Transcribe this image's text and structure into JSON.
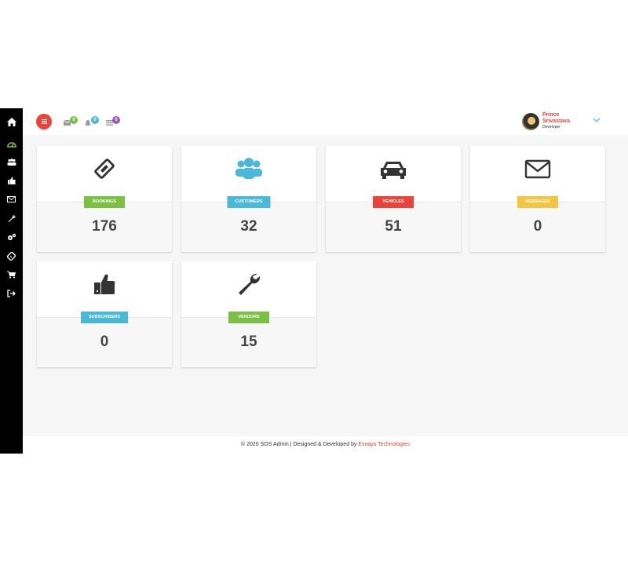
{
  "colors": {
    "sidebar_bg": "#000000",
    "accent_red": "#e8443a",
    "green": "#7ac143",
    "blue": "#4ab8d8",
    "yellow": "#f4c542",
    "purple": "#9b59b6"
  },
  "sidebar": {
    "items": [
      {
        "icon": "home-icon",
        "active": false
      },
      {
        "icon": "dashboard-icon",
        "active": true
      },
      {
        "icon": "users-icon",
        "active": false
      },
      {
        "icon": "thumbs-up-icon",
        "active": false
      },
      {
        "icon": "envelope-icon",
        "active": false
      },
      {
        "icon": "wrench-icon",
        "active": false
      },
      {
        "icon": "gears-icon",
        "active": false
      },
      {
        "icon": "ticket-icon",
        "active": false
      },
      {
        "icon": "cart-icon",
        "active": false
      },
      {
        "icon": "sign-out-icon",
        "active": false
      }
    ]
  },
  "topbar": {
    "menu_icon": "hamburger-icon",
    "notifications": [
      {
        "icon": "envelope-icon",
        "count": "0",
        "color": "#7ac143"
      },
      {
        "icon": "bell-icon",
        "count": "0",
        "color": "#4ab8d8"
      },
      {
        "icon": "tasks-icon",
        "count": "0",
        "color": "#9b59b6"
      }
    ],
    "user": {
      "name": "Prince Srivastava",
      "role": "Developer"
    },
    "dropdown_icon": "chevron-down-icon"
  },
  "cards": [
    {
      "label": "BOOKINGS",
      "value": "176",
      "icon": "ticket-icon",
      "color": "#7ac143"
    },
    {
      "label": "CUSTOMERS",
      "value": "32",
      "icon": "users-icon",
      "color": "#4ab8d8"
    },
    {
      "label": "VEHICLES",
      "value": "51",
      "icon": "car-icon",
      "color": "#e8443a"
    },
    {
      "label": "MESSAGES",
      "value": "0",
      "icon": "envelope-icon",
      "color": "#f4c542"
    },
    {
      "label": "SUBSCRIBERS",
      "value": "0",
      "icon": "thumbs-up-icon",
      "color": "#4ab8d8"
    },
    {
      "label": "VENDORS",
      "value": "15",
      "icon": "wrench-icon",
      "color": "#7ac143"
    }
  ],
  "footer": {
    "text": "© 2020 SOS Admin | Designed & Developed by ",
    "brand": "Evoqys Technologies"
  }
}
